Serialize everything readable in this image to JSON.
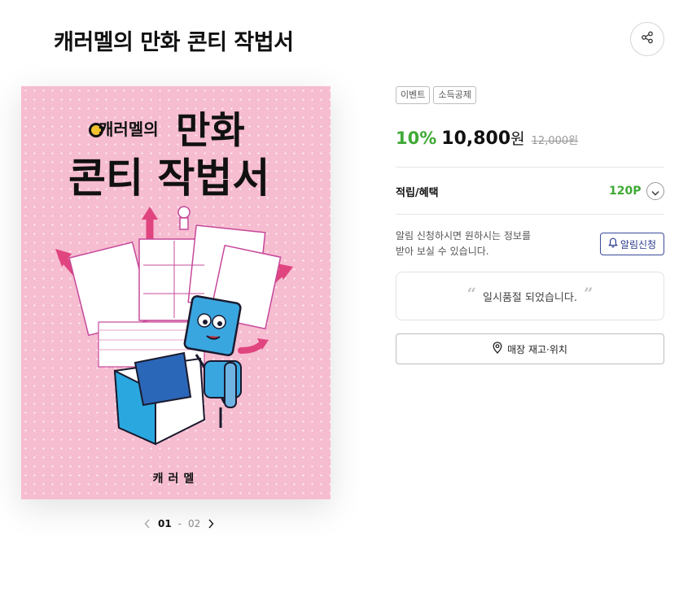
{
  "product": {
    "title": "캐러멜의 만화 콘티 작법서",
    "cover": {
      "series_label": "캐러멜의",
      "title_line1": "만화",
      "title_line2": "콘티 작법서",
      "author": "캐러멜"
    }
  },
  "pager": {
    "current": "01",
    "separator": "-",
    "total": "02"
  },
  "tags": [
    "이벤트",
    "소득공제"
  ],
  "pricing": {
    "discount": "10%",
    "price": "10,800",
    "currency": "원",
    "original": "12,000원"
  },
  "points": {
    "label": "적립/혜택",
    "value": "120P"
  },
  "notify": {
    "text_line1": "알림 신청하시면 원하시는 정보를",
    "text_line2": "받아 보실 수 있습니다.",
    "button": "알림신청"
  },
  "soldout": {
    "message": "일시품절 되었습니다."
  },
  "store": {
    "button": "매장 재고·위치"
  },
  "icons": {
    "share": "share-icon",
    "bell": "bell-icon",
    "location": "location-pin-icon",
    "chevron": "chevron-down-icon"
  },
  "colors": {
    "accent_green": "#3fa935",
    "notify_blue": "#3b4a9b",
    "cover_pink": "#f6bcd0",
    "arrow_pink": "#e0457f"
  }
}
